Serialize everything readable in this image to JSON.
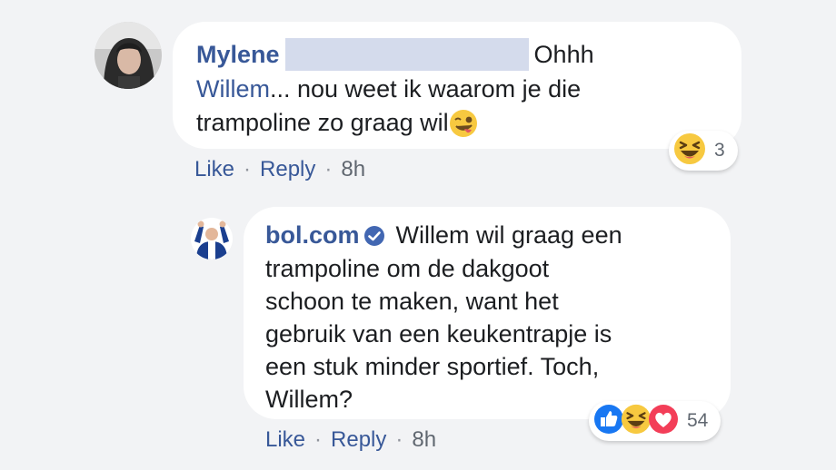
{
  "comment1": {
    "author": "Mylene",
    "text_part1": "Ohhh",
    "mention": "Willem",
    "text_part2": "... nou weet ik waarom je die",
    "text_line3": "trampoline zo graag wil",
    "emoji": "winking-face-tongue",
    "reaction_count": "3",
    "actions": {
      "like": "Like",
      "reply": "Reply",
      "time": "8h"
    }
  },
  "reply1": {
    "author": "bol.com",
    "lines": [
      "Willem wil graag een",
      "trampoline om de dakgoot",
      "schoon te maken, want het",
      "gebruik van een keukentrapje is",
      "een stuk minder sportief. Toch,",
      "Willem?"
    ],
    "reaction_count": "54",
    "actions": {
      "like": "Like",
      "reply": "Reply",
      "time": "8h"
    }
  },
  "colors": {
    "link": "#385898",
    "text": "#1c1e21",
    "meta": "#606770",
    "background": "#f2f3f5",
    "like_blue": "#1877f2",
    "love_red": "#f33e58",
    "emoji_yellow": "#f7c940"
  }
}
